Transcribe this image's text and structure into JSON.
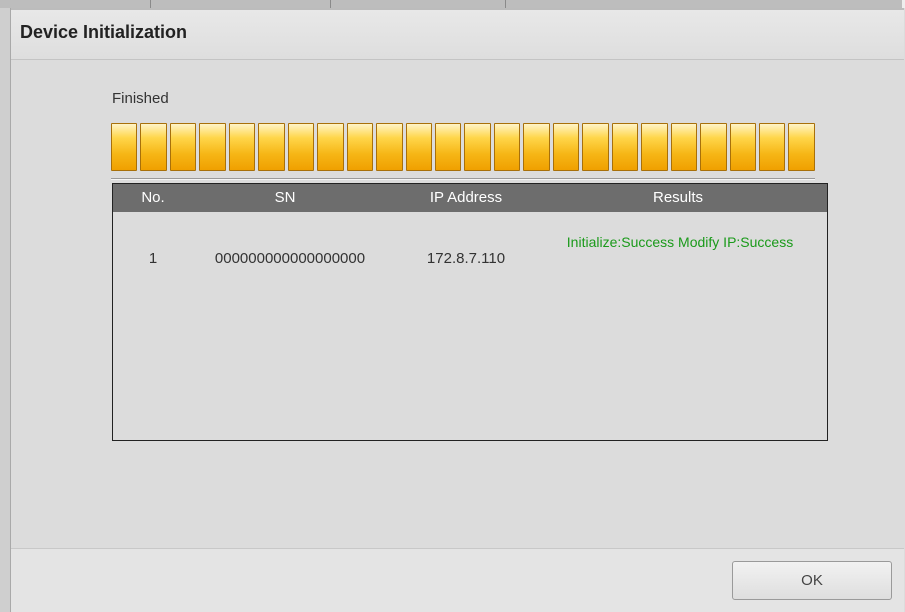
{
  "dialog": {
    "title": "Device Initialization",
    "status_label": "Finished",
    "progress_fraction": 1.0,
    "progress_segments": 24
  },
  "results": {
    "columns": [
      "No.",
      "SN",
      "IP Address",
      "Results"
    ],
    "rows": [
      {
        "no": "1",
        "sn": "000000000000000000",
        "ip": "172.8.7.110",
        "result": "Initialize:Success Modify IP:Success"
      }
    ]
  },
  "footer": {
    "ok_label": "OK"
  },
  "colors": {
    "progress_fill": "#f6b616",
    "table_header_bg": "#6d6d6d",
    "success_text": "#1a9a1a"
  }
}
